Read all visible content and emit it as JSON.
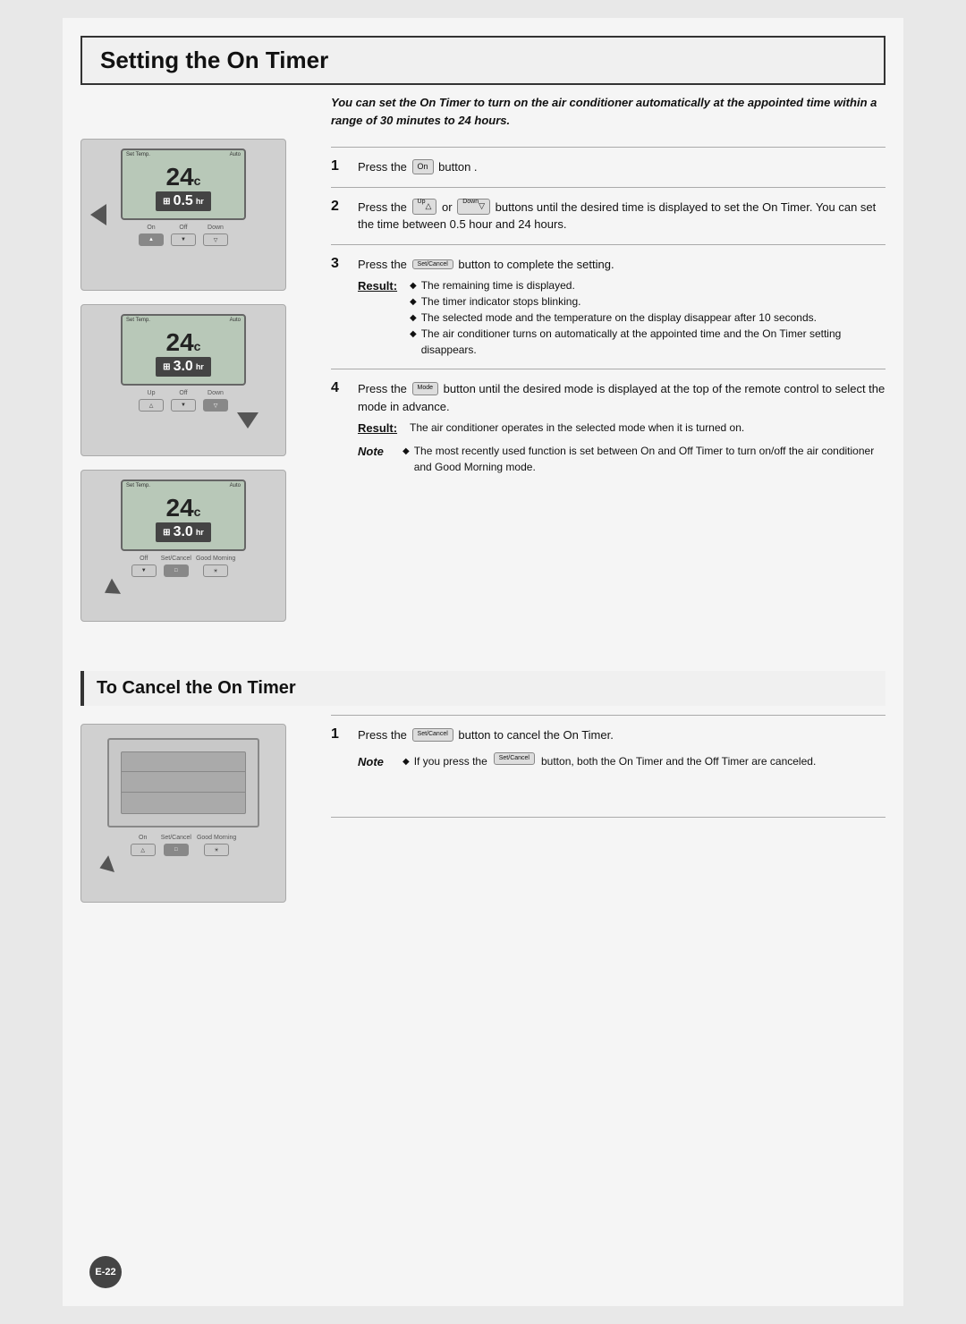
{
  "page": {
    "title": "Setting the On Timer",
    "badge": "E-22"
  },
  "intro": {
    "text": "You can set the On Timer to turn on the air conditioner automatically at the appointed time within a range of 30 minutes to 24 hours."
  },
  "steps": [
    {
      "number": "1",
      "text_before": "Press the",
      "button": "On",
      "text_after": "button ."
    },
    {
      "number": "2",
      "text_before": "Press the",
      "button_up": "Up",
      "or_text": "or",
      "button_down": "Down",
      "text_after": "buttons until the desired time is displayed to set the On Timer. You can set the time between 0.5 hour and 24 hours."
    },
    {
      "number": "3",
      "text_before": "Press the",
      "button": "Set/Cancel",
      "text_after": "button to complete the setting.",
      "result_label": "Result:",
      "result_items": [
        "The remaining time is displayed.",
        "The timer indicator stops blinking.",
        "The selected mode and the temperature on the display disappear after 10 seconds.",
        "The air conditioner turns on automatically at the appointed time and the On Timer setting disappears."
      ]
    },
    {
      "number": "4",
      "text_before": "Press the",
      "button": "Mode",
      "text_after": "button until the desired mode is displayed at the top of the remote control to select the mode in advance.",
      "result_label": "Result:",
      "result_text": "The air conditioner operates in the selected mode when it is turned on.",
      "note_label": "Note",
      "note_text": "The most recently used function is set between On and Off Timer to turn on/off the air conditioner and Good Morning mode."
    }
  ],
  "cancel_section": {
    "title": "To Cancel the On Timer",
    "steps": [
      {
        "number": "1",
        "text_before": "Press the",
        "button": "Set/Cancel",
        "text_after": "button to cancel the On Timer.",
        "note_label": "Note",
        "note_text": "If you press the",
        "note_button": "Set/Cancel",
        "note_text2": "button, both the On Timer and the Off Timer are canceled."
      }
    ]
  },
  "remotes": [
    {
      "id": "remote1",
      "temp": "24c",
      "timer": "0.5hr",
      "show_on_arrow": true,
      "highlight_btn": "on"
    },
    {
      "id": "remote2",
      "temp": "24c",
      "timer": "3.0hr",
      "show_down_arrow": true,
      "highlight_btn": "down"
    },
    {
      "id": "remote3",
      "temp": "24c",
      "timer": "3.0hr",
      "show_setcancel_arrow": true,
      "highlight_btn": "setcancel"
    },
    {
      "id": "remote4",
      "cancel_mode": true
    }
  ]
}
